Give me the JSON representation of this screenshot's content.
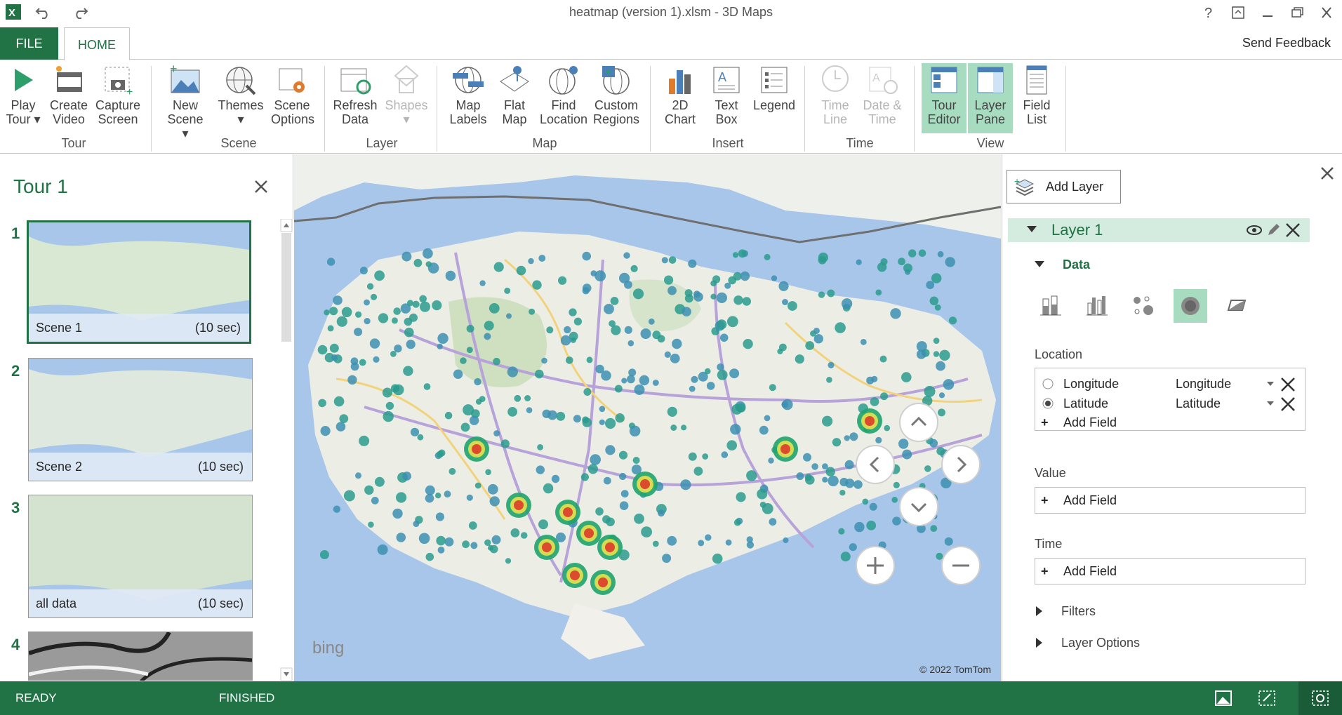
{
  "window": {
    "title": "heatmap (version 1).xlsm - 3D Maps",
    "app_icon": "excel-icon"
  },
  "tabs": {
    "file": "FILE",
    "home": "HOME",
    "send_feedback": "Send Feedback"
  },
  "ribbon": {
    "play_tour": [
      "Play",
      "Tour ▾"
    ],
    "create_video": [
      "Create",
      "Video"
    ],
    "capture_screen": [
      "Capture",
      "Screen"
    ],
    "new_scene": [
      "New",
      "Scene ▾"
    ],
    "themes": [
      "Themes",
      "▾"
    ],
    "scene_options": [
      "Scene",
      "Options"
    ],
    "refresh_data": [
      "Refresh",
      "Data"
    ],
    "shapes": [
      "Shapes",
      "▾"
    ],
    "map_labels": [
      "Map",
      "Labels"
    ],
    "flat_map": [
      "Flat",
      "Map"
    ],
    "find_location": [
      "Find",
      "Location"
    ],
    "custom_regions": [
      "Custom",
      "Regions"
    ],
    "chart_2d": [
      "2D",
      "Chart"
    ],
    "text_box": [
      "Text",
      "Box"
    ],
    "legend": [
      "Legend",
      ""
    ],
    "time_line": [
      "Time",
      "Line"
    ],
    "date_time": [
      "Date &",
      "Time"
    ],
    "tour_editor": [
      "Tour",
      "Editor"
    ],
    "layer_pane": [
      "Layer",
      "Pane"
    ],
    "field_list": [
      "Field",
      "List"
    ],
    "groups": {
      "tour": "Tour",
      "scene": "Scene",
      "layer": "Layer",
      "map": "Map",
      "insert": "Insert",
      "time": "Time",
      "view": "View"
    }
  },
  "tour": {
    "title": "Tour 1",
    "scenes": [
      {
        "num": "1",
        "name": "Scene 1",
        "duration": "(10 sec)"
      },
      {
        "num": "2",
        "name": "Scene 2",
        "duration": "(10 sec)"
      },
      {
        "num": "3",
        "name": "all data",
        "duration": "(10 sec)"
      },
      {
        "num": "4",
        "name": "",
        "duration": ""
      }
    ]
  },
  "map": {
    "attribution_logo": "bing",
    "copyright": "© 2022 TomTom"
  },
  "layer_pane": {
    "add_layer": "Add Layer",
    "layer_name": "Layer 1",
    "data_label": "Data",
    "location_label": "Location",
    "location_fields": [
      {
        "name": "Longitude",
        "type": "Longitude",
        "selected": false
      },
      {
        "name": "Latitude",
        "type": "Latitude",
        "selected": true
      }
    ],
    "add_field": "Add Field",
    "value_label": "Value",
    "time_label": "Time",
    "filters": "Filters",
    "layer_options": "Layer Options",
    "active_viz": "heat-map",
    "colors": {
      "accent": "#217346",
      "highlight": "#a8dcc1",
      "layer_header": "#d3ecdf"
    }
  },
  "status": {
    "ready": "READY",
    "finished": "FINISHED"
  }
}
